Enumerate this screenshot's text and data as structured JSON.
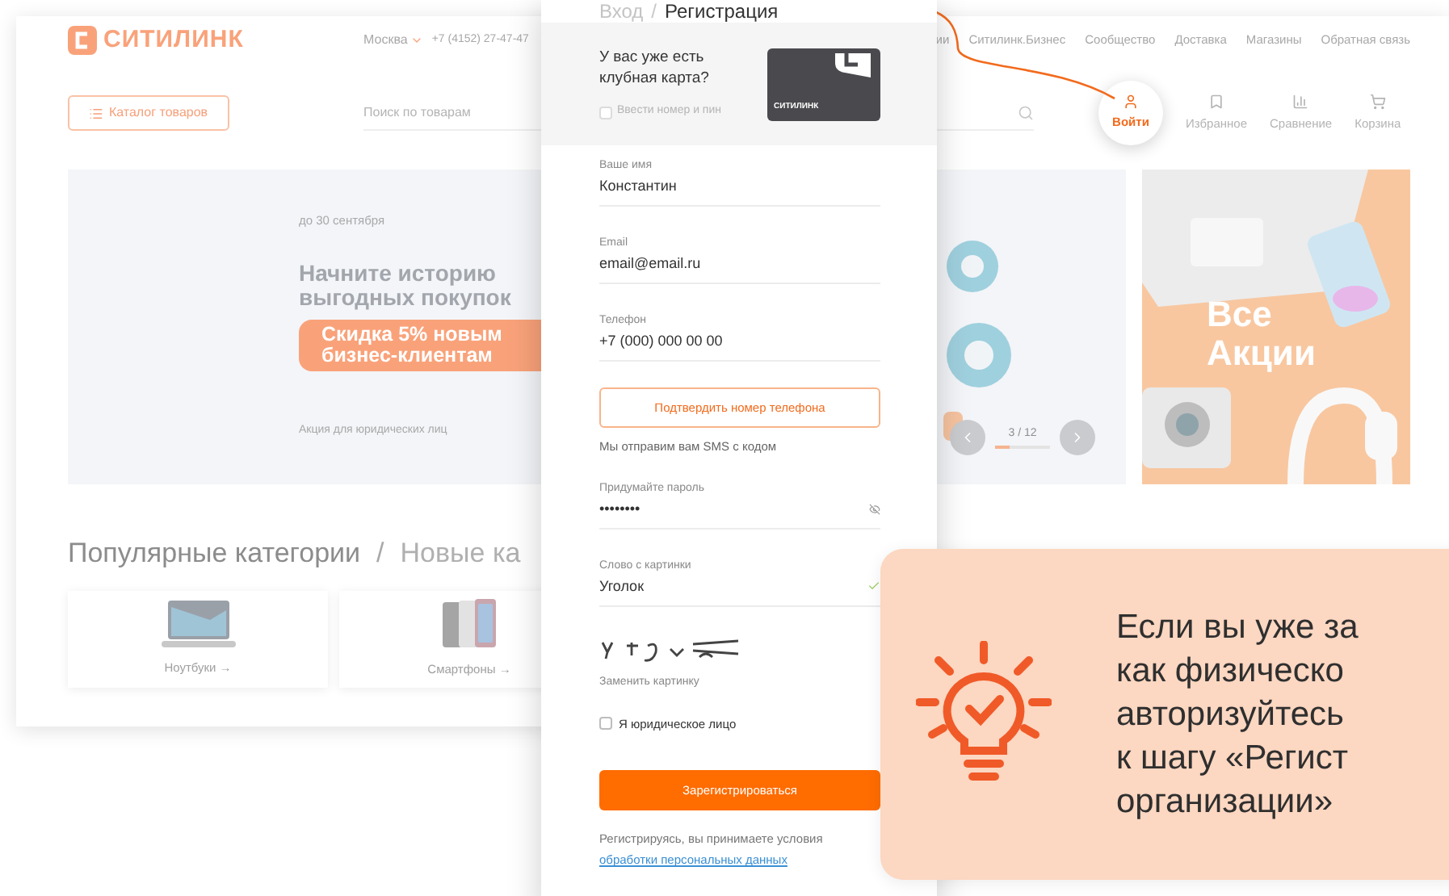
{
  "site": {
    "logo": "СИТИЛИНК",
    "city": "Москва",
    "phone": "+7 (4152) 27-47-47",
    "nav": [
      "ии",
      "Ситилинк.Бизнес",
      "Сообщество",
      "Доставка",
      "Магазины",
      "Обратная связь"
    ],
    "catalog_button": "Каталог товаров",
    "search": {
      "placeholder": "Поиск по товарам"
    },
    "actions": [
      {
        "label": "Войти",
        "selected": true,
        "kind": "user"
      },
      {
        "label": "Избранное",
        "selected": false,
        "kind": "bookmark"
      },
      {
        "label": "Сравнение",
        "selected": false,
        "kind": "compare"
      },
      {
        "label": "Корзина",
        "selected": false,
        "kind": "cart"
      }
    ],
    "banner": {
      "date": "до 30 сентября",
      "title_lines": [
        "Начните историю",
        "выгодных покупок"
      ],
      "badge_lines": [
        "Скидка 5% новым",
        "бизнес-клиентам"
      ],
      "note": "Акция для юридических лиц",
      "counter": "3 / 12",
      "level": 0.25
    },
    "promo": {
      "title_lines": [
        "Все",
        "Акции"
      ]
    },
    "categories": {
      "tabs": [
        {
          "label": "Популярные категории",
          "selected": true
        },
        {
          "label": "Новые ка",
          "selected": false
        }
      ],
      "separator": "/",
      "items": [
        {
          "label": "Ноутбуки →",
          "kind": "laptop"
        },
        {
          "label": "Смартфоны →",
          "kind": "phone"
        }
      ]
    }
  },
  "modal": {
    "tabs": [
      {
        "label": "Вход",
        "selected": false
      },
      {
        "label": "Регистрация",
        "selected": true
      }
    ],
    "separator": "/",
    "club": {
      "question": "У вас уже есть клубная карта?",
      "checkbox": {
        "label": "Ввести номер и пин",
        "checked": false
      },
      "card_logo": "СИТИЛИНК"
    },
    "fields": [
      {
        "label": "Ваше имя",
        "value": "Константин"
      },
      {
        "label": "Email",
        "value": "email@email.ru"
      },
      {
        "label": "Телефон",
        "value": "+7 (000) 000 00 00"
      }
    ],
    "confirm_button": "Подтвердить номер телефона",
    "sms_note": "Мы отправим вам SMS с кодом",
    "password": {
      "label": "Придумайте пароль",
      "value": "••••••••"
    },
    "captcha_field": {
      "label": "Слово с картинки",
      "value": "Уголок",
      "valid": true
    },
    "captcha_refresh": "Заменить картинку",
    "legal_checkbox": {
      "label": "Я юридическое лицо",
      "checked": false
    },
    "submit": "Зарегистрироваться",
    "terms": "Регистрируясь, вы принимаете условия",
    "terms_link": "обработки персональных данных"
  },
  "callout": {
    "lines": [
      "Если вы уже за",
      "как физическо",
      "авторизуйтесь",
      "к шагу «Регист",
      "организации»"
    ]
  }
}
